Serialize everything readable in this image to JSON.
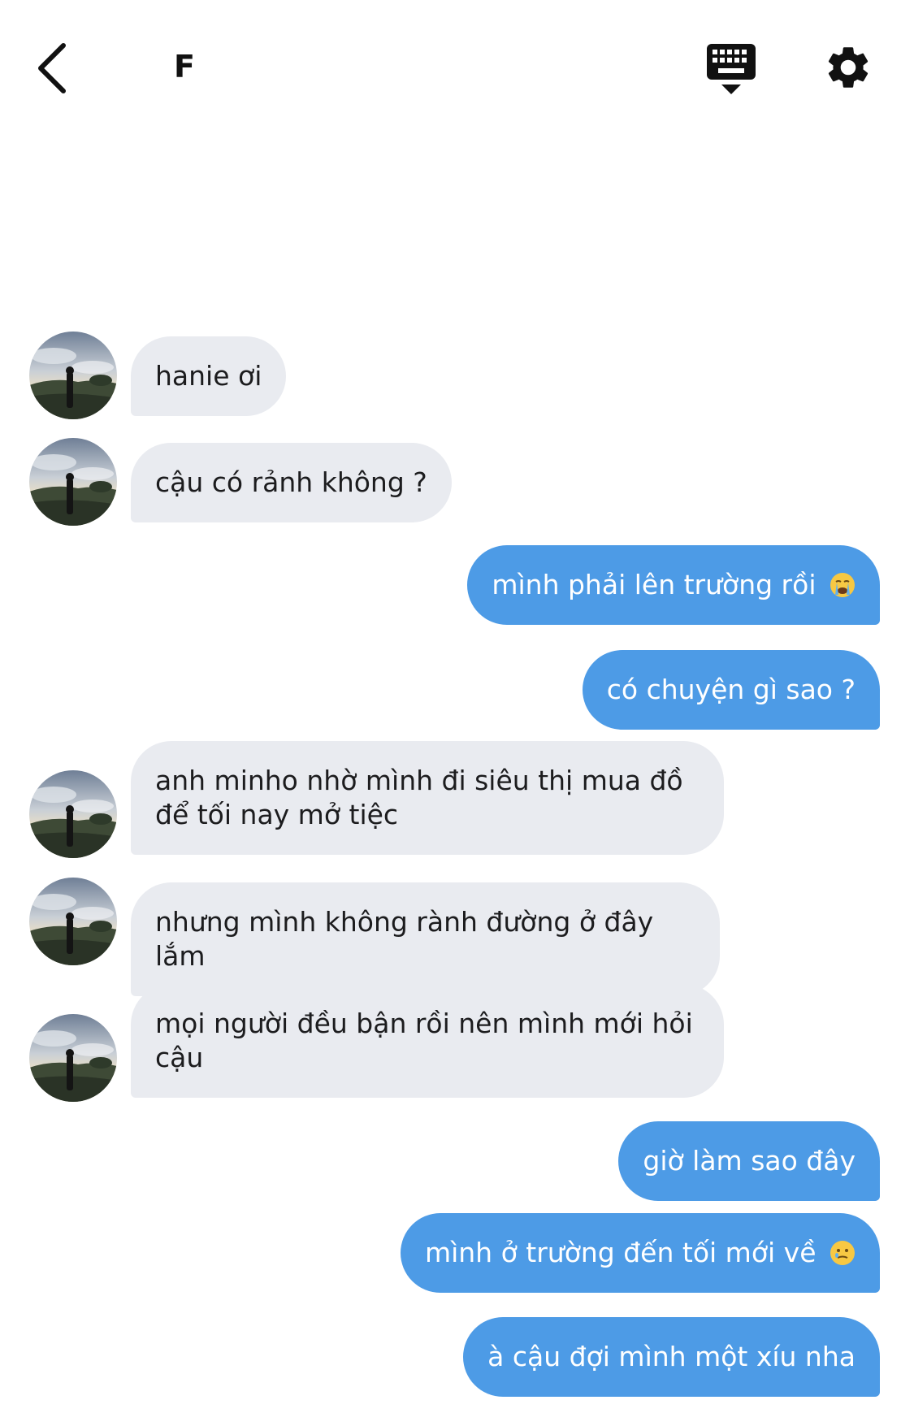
{
  "header": {
    "title": "F",
    "back_icon": "chevron-left-icon",
    "keyboard_icon": "keyboard-hide-icon",
    "settings_icon": "gear-icon"
  },
  "colors": {
    "incoming_bubble": "#e9ebf0",
    "outgoing_bubble": "#4d9be6",
    "incoming_text": "#1c1c1e",
    "outgoing_text": "#ffffff"
  },
  "messages": [
    {
      "sender": "contact",
      "text": "hanie ơi"
    },
    {
      "sender": "contact",
      "text": "cậu có rảnh không ?"
    },
    {
      "sender": "me",
      "text": "mình phải lên trường rồi",
      "emoji": "crying-face-emoji"
    },
    {
      "sender": "me",
      "text": "có chuyện gì sao ?"
    },
    {
      "sender": "contact",
      "text": "anh minho nhờ mình đi siêu thị mua đồ để tối nay mở tiệc"
    },
    {
      "sender": "contact",
      "text": "nhưng mình không rành đường ở đây lắm"
    },
    {
      "sender": "contact",
      "text": "mọi người đều bận rồi nên mình mới hỏi cậu"
    },
    {
      "sender": "me",
      "text": "giờ làm sao đây"
    },
    {
      "sender": "me",
      "text": "mình ở trường đến tối mới về",
      "emoji": "teary-smile-emoji"
    },
    {
      "sender": "me",
      "text": "à cậu đợi mình một xíu nha"
    }
  ]
}
